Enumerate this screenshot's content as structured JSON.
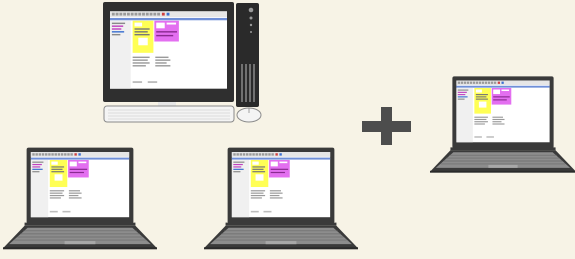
{
  "devices": [
    {
      "kind": "desktop",
      "name": "desktop-computer"
    },
    {
      "kind": "laptop",
      "name": "laptop-bottom-left"
    },
    {
      "kind": "laptop",
      "name": "laptop-bottom-center"
    },
    {
      "kind": "laptop",
      "name": "laptop-right"
    }
  ],
  "plus_sign": "+",
  "colors": {
    "background": "#f7f3e6",
    "frame": "#3a3a3a",
    "keyboard": "#8d8d8d",
    "panel_yellow": "#ffff55",
    "panel_magenta": "#e36ff0",
    "screen_bg": "#ffffff",
    "plus": "#4d4d4d"
  }
}
